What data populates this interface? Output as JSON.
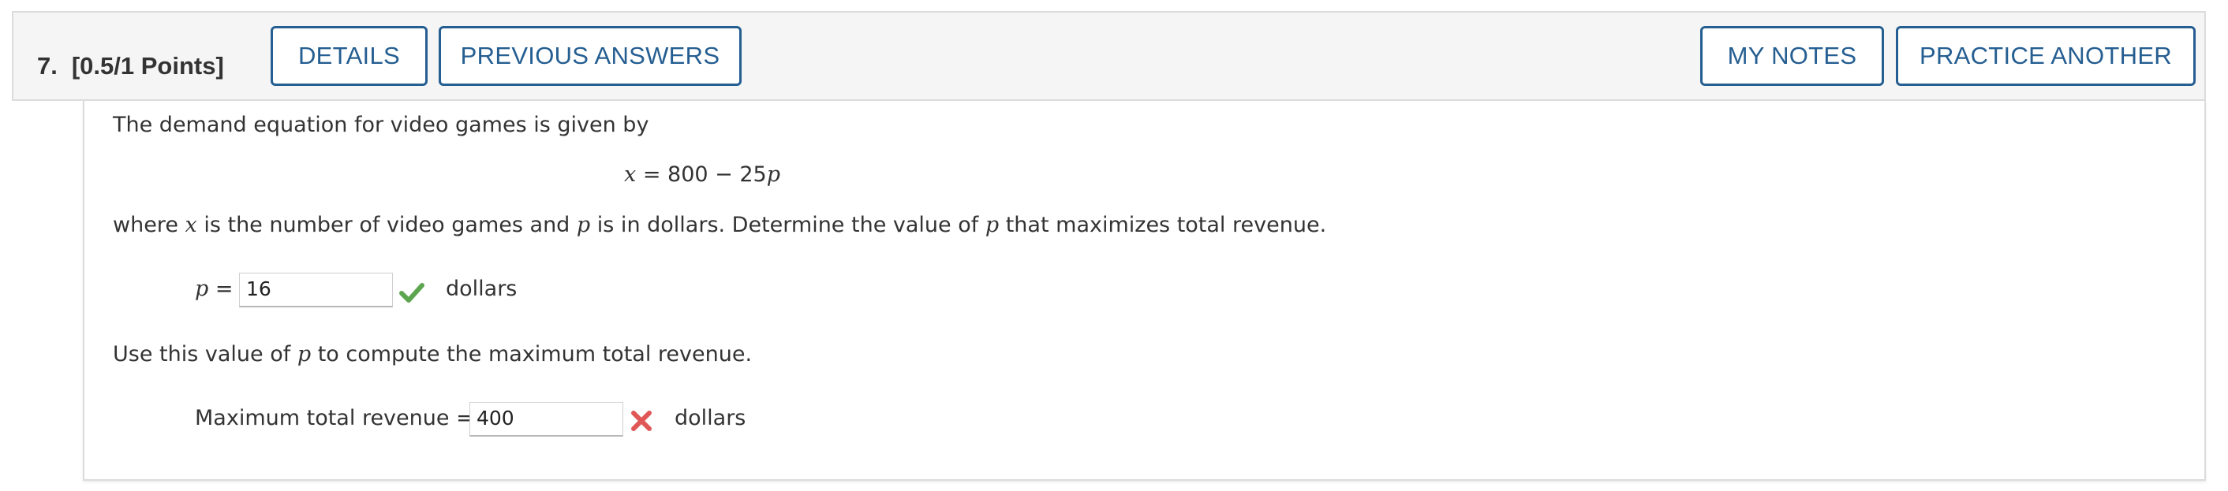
{
  "question": {
    "number": "7.",
    "points": "[0.5/1 Points]"
  },
  "buttons": {
    "details": "DETAILS",
    "previous_answers": "PREVIOUS ANSWERS",
    "my_notes": "MY NOTES",
    "practice_another": "PRACTICE ANOTHER"
  },
  "problem": {
    "intro": "The demand equation for video games is given by",
    "equation": {
      "lhs": "x",
      "rhs": "= 800 − 25",
      "var": "p"
    },
    "where_text": {
      "part1": "where ",
      "var_x": "x",
      "part2": " is the number of video games and ",
      "var_p1": "p",
      "part3": " is in dollars. Determine the value of ",
      "var_p2": "p",
      "part4": " that maximizes total revenue."
    },
    "answer1": {
      "label_var": "p",
      "label_eq": " = ",
      "value": "16",
      "unit": "dollars",
      "status": "correct"
    },
    "use_text": {
      "part1": "Use this value of ",
      "var_p": "p",
      "part2": " to compute the maximum total revenue."
    },
    "answer2": {
      "label": "Maximum total revenue =",
      "value": "400",
      "unit": "dollars",
      "status": "incorrect"
    }
  },
  "colors": {
    "accent": "#255e91",
    "correct": "#5da64f",
    "incorrect": "#e05757"
  },
  "icons": {
    "correct": "checkmark-icon",
    "incorrect": "x-mark-icon"
  }
}
